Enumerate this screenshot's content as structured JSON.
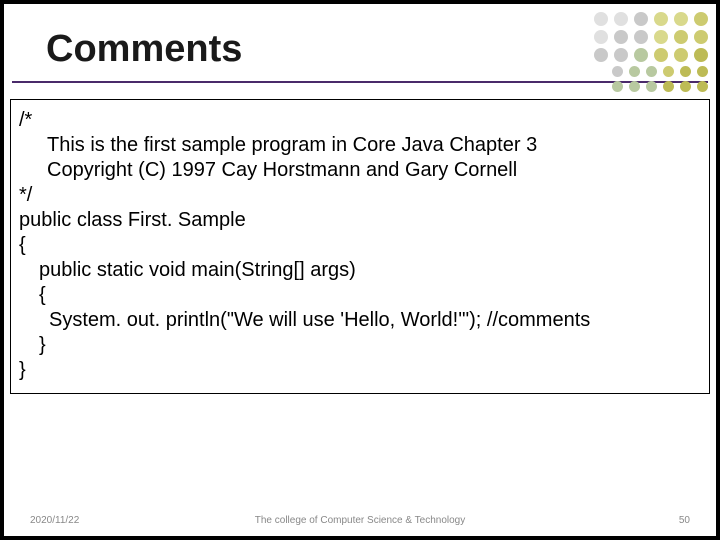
{
  "title": "Comments",
  "code": {
    "l1": "/*",
    "l2": "This is the first sample program in Core Java Chapter 3",
    "l3": "Copyright (C) 1997 Cay Horstmann and Gary Cornell",
    "l4": "*/",
    "l5": "public class First. Sample",
    "l6": "{",
    "l7": "public static void main(String[] args)",
    "l8": "{",
    "l9": "System. out. println(\"We will use 'Hello, World!'\"); //comments",
    "l10": "}",
    "l11": "}"
  },
  "footer": {
    "date": "2020/11/22",
    "center": "The college of Computer Science & Technology",
    "page": "50"
  }
}
